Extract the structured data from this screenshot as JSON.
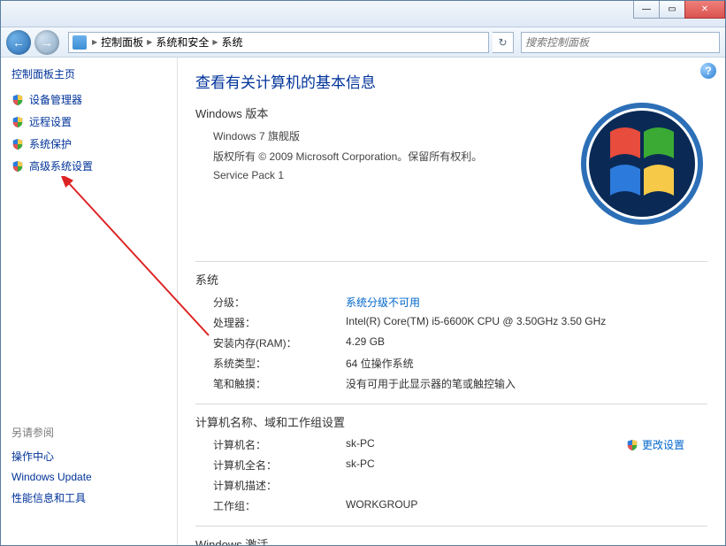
{
  "titlebar": {
    "minimize_glyph": "—",
    "maximize_glyph": "▭",
    "close_glyph": "✕"
  },
  "nav": {
    "back_glyph": "←",
    "forward_glyph": "→",
    "refresh_glyph": "↻"
  },
  "breadcrumb": {
    "sep": "▶",
    "items": [
      "控制面板",
      "系统和安全",
      "系统"
    ]
  },
  "search": {
    "placeholder": "搜索控制面板"
  },
  "help": {
    "glyph": "?"
  },
  "sidebar": {
    "home_title": "控制面板主页",
    "links": [
      {
        "label": "设备管理器",
        "shield": true
      },
      {
        "label": "远程设置",
        "shield": true
      },
      {
        "label": "系统保护",
        "shield": true
      },
      {
        "label": "高级系统设置",
        "shield": true
      }
    ],
    "see_also_title": "另请参阅",
    "see_also": [
      {
        "label": "操作中心"
      },
      {
        "label": "Windows Update"
      },
      {
        "label": "性能信息和工具"
      }
    ]
  },
  "main": {
    "title": "查看有关计算机的基本信息",
    "edition_label": "Windows 版本",
    "edition": {
      "name": "Windows 7 旗舰版",
      "copyright": "版权所有 © 2009 Microsoft Corporation。保留所有权利。",
      "sp": "Service Pack 1"
    },
    "system_label": "系统",
    "system": {
      "rating_k": "分级：",
      "rating_v": "系统分级不可用",
      "cpu_k": "处理器：",
      "cpu_v": "Intel(R) Core(TM) i5-6600K CPU @ 3.50GHz   3.50 GHz",
      "ram_k": "安装内存(RAM)：",
      "ram_v": "4.29 GB",
      "type_k": "系统类型：",
      "type_v": "64 位操作系统",
      "pen_k": "笔和触摸：",
      "pen_v": "没有可用于此显示器的笔或触控输入"
    },
    "computer_label": "计算机名称、域和工作组设置",
    "computer": {
      "name_k": "计算机名：",
      "name_v": "sk-PC",
      "full_k": "计算机全名：",
      "full_v": "sk-PC",
      "desc_k": "计算机描述：",
      "desc_v": "",
      "wg_k": "工作组：",
      "wg_v": "WORKGROUP",
      "change_label": "更改设置"
    },
    "activation_label": "Windows 激活"
  }
}
